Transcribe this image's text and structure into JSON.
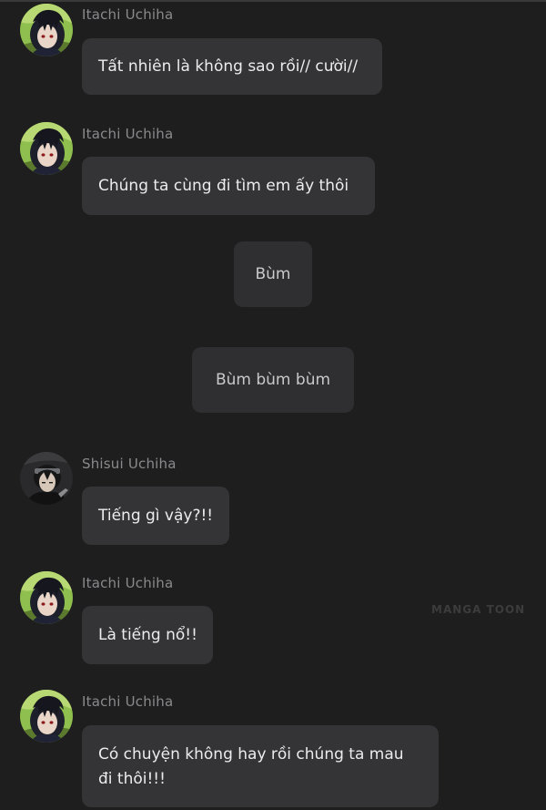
{
  "messages": [
    {
      "sender": "Itachi Uchiha",
      "text": "Tất nhiên là không sao rồi// cười//"
    },
    {
      "sender": "Itachi Uchiha",
      "text": "Chúng ta cùng đi tìm em ấy thôi"
    },
    {
      "sender": "Shisui Uchiha",
      "text": "Tiếng gì vậy?!!"
    },
    {
      "sender": "Itachi Uchiha",
      "text": "Là tiếng nổ!!"
    },
    {
      "sender": "Itachi Uchiha",
      "text": "Có chuyện không hay rồi chúng ta mau đi thôi!!!"
    }
  ],
  "system_messages": [
    {
      "text": "Bùm"
    },
    {
      "text": "Bùm bùm bùm"
    }
  ],
  "watermark": "MANGA TOON",
  "colors": {
    "background": "#1e1e1f",
    "bubble": "#343436",
    "bubble_text": "#ececec",
    "sender_text": "#8a8a8c"
  },
  "icons": {
    "itachi_avatar": "itachi-avatar",
    "shisui_avatar": "shisui-avatar"
  }
}
